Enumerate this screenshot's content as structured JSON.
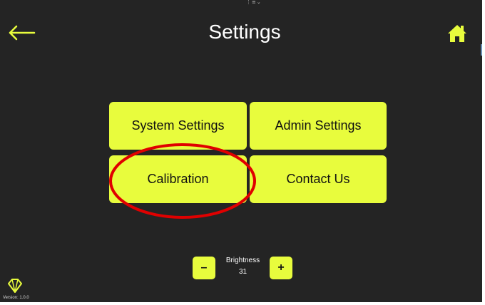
{
  "header": {
    "title": "Settings",
    "back_icon": "arrow-left-icon",
    "home_icon": "home-icon"
  },
  "menu": {
    "items": [
      {
        "label": "System Settings"
      },
      {
        "label": "Admin Settings"
      },
      {
        "label": "Calibration"
      },
      {
        "label": "Contact Us"
      }
    ]
  },
  "brightness": {
    "label": "Brightness",
    "value": "31",
    "decrease_label": "–",
    "increase_label": "+"
  },
  "footer": {
    "version": "Version: 1.0.0",
    "logo_icon": "diamond-logo-icon"
  },
  "colors": {
    "background": "#242424",
    "accent": "#e8fc3d",
    "annotation": "#e00000",
    "text_on_accent": "#111111",
    "text_on_dark": "#ffffff"
  }
}
